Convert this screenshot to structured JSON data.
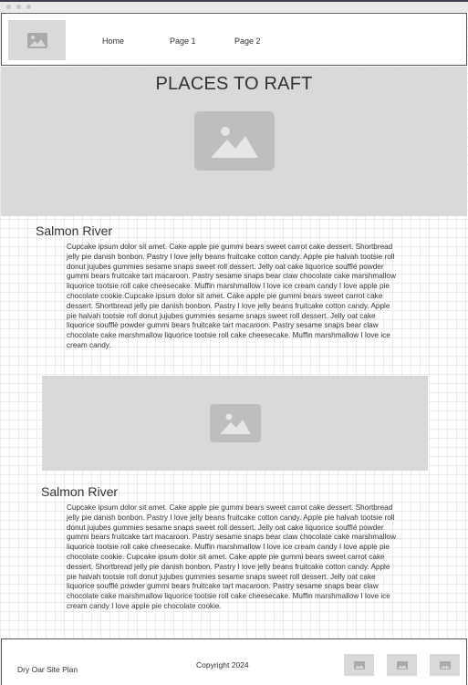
{
  "nav": {
    "links": [
      "Home",
      "Page 1",
      "Page 2"
    ]
  },
  "hero": {
    "title": "PLACES TO RAFT"
  },
  "sections": [
    {
      "title": "Salmon River",
      "text": "Cupcake ipsum dolor sit amet. Cake apple pie gummi bears sweet carrot cake dessert. Shortbread jelly pie danish bonbon. Pastry I love jelly beans fruitcake cotton candy. Apple pie halvah tootsie roll donut jujubes gummies sesame snaps sweet roll dessert. Jelly oat cake liquorice soufflé powder gummi bears fruitcake tart macaroon. Pastry sesame snaps bear claw chocolate cake marshmallow liquorice tootsie roll cake cheesecake. Muffin marshmallow I love ice cream candy I love apple pie chocolate cookie.Cupcake ipsum dolor sit amet. Cake apple pie gummi bears sweet carrot cake dessert. Shortbread jelly pie danish bonbon. Pastry I love jelly beans fruitcake cotton candy. Apple pie halvah tootsie roll donut jujubes gummies sesame snaps sweet roll dessert. Jelly oat cake liquorice soufflé powder gummi bears fruitcake tart macaroon. Pastry sesame snaps bear claw chocolate cake marshmallow liquorice tootsie roll cake cheesecake. Muffin marshmallow I love ice cream candy."
    },
    {
      "title": "Salmon River",
      "text": "Cupcake ipsum dolor sit amet. Cake apple pie gummi bears sweet carrot cake dessert. Shortbread jelly pie danish bonbon. Pastry I love jelly beans fruitcake cotton candy. Apple pie halvah tootsie roll donut jujubes gummies sesame snaps sweet roll dessert. Jelly oat cake liquorice soufflé powder gummi bears fruitcake tart macaroon. Pastry sesame snaps bear claw chocolate cake marshmallow liquorice tootsie roll cake cheesecake. Muffin marshmallow I love ice cream candy I love apple pie chocolate cookie. Cupcake ipsum dolor sit amet. Cake apple pie gummi bears sweet carrot cake dessert. Shortbread jelly pie danish bonbon. Pastry I love jelly beans fruitcake cotton candy. Apple pie halvah tootsie roll donut jujubes gummies sesame snaps sweet roll dessert. Jelly oat cake liquorice soufflé powder gummi bears fruitcake tart macaroon. Pastry sesame snaps bear claw chocolate cake marshmallow liquorice tootsie roll cake cheesecake. Muffin marshmallow I love ice cream candy I love apple pie chocolate cookie."
    }
  ],
  "footer": {
    "site_name": "Dry Oar Site Plan",
    "copyright": "Copyright 2024"
  },
  "icons": {
    "image_placeholder": "image-placeholder-icon"
  },
  "colors": {
    "placeholder_bg": "#d9d9d9",
    "placeholder_icon": "#bebebe",
    "border": "#555555"
  }
}
